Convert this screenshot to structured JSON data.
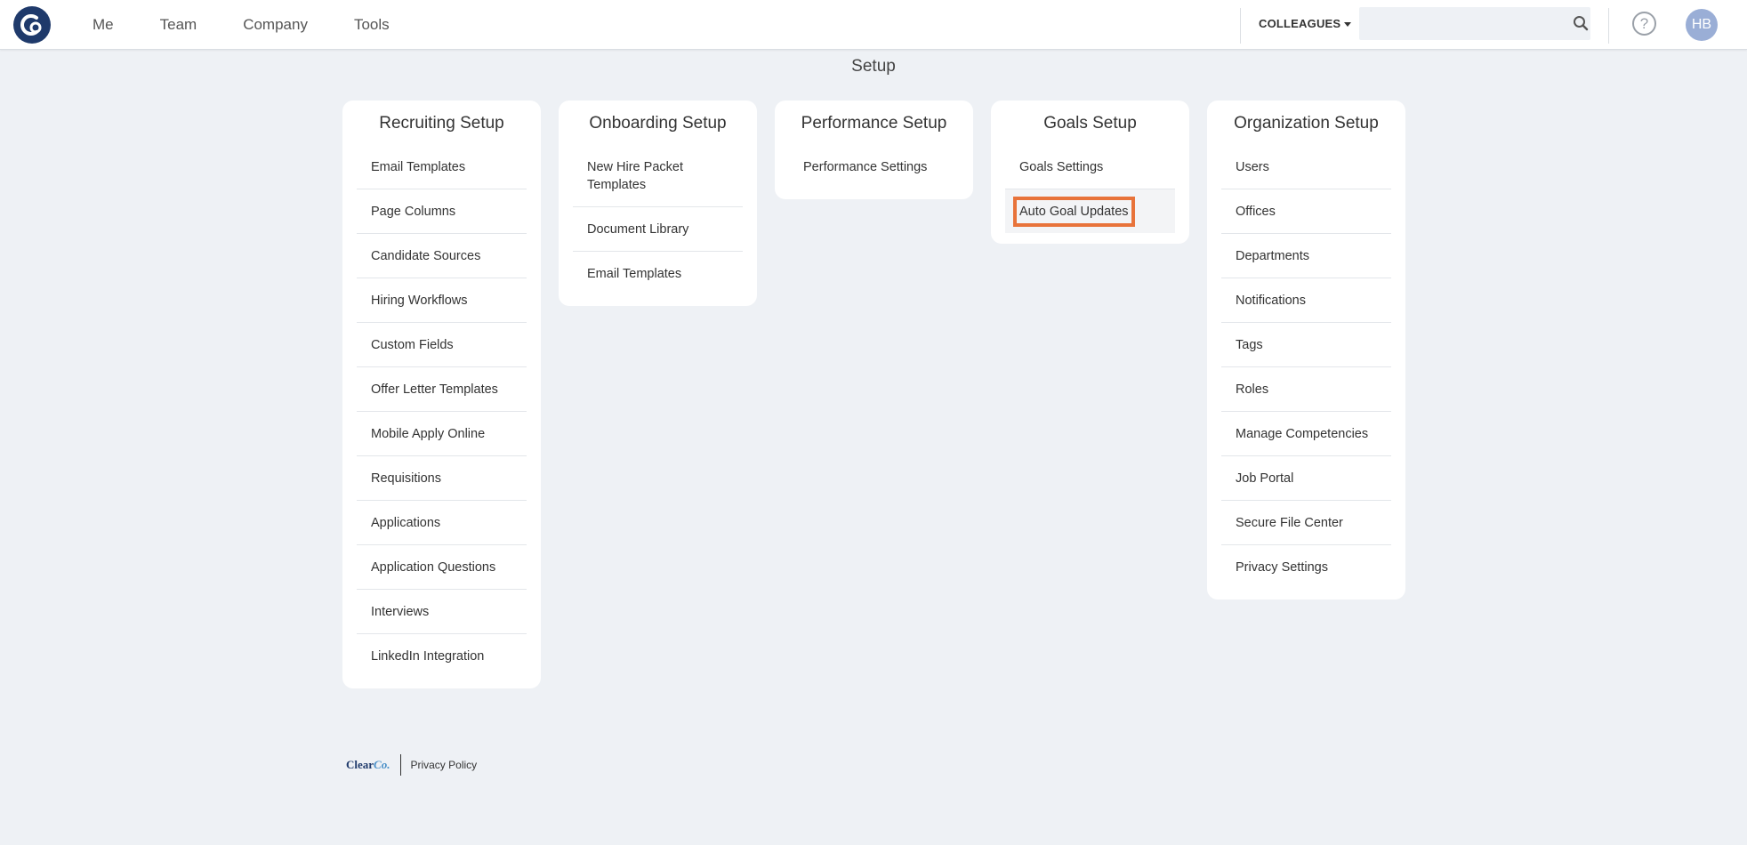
{
  "nav": {
    "items": [
      "Me",
      "Team",
      "Company",
      "Tools"
    ],
    "colleagues_label": "COLLEAGUES",
    "search_placeholder": "",
    "help_label": "?",
    "avatar_initials": "HB"
  },
  "page": {
    "title": "Setup"
  },
  "cards": [
    {
      "title": "Recruiting Setup",
      "items": [
        "Email Templates",
        "Page Columns",
        "Candidate Sources",
        "Hiring Workflows",
        "Custom Fields",
        "Offer Letter Templates",
        "Mobile Apply Online",
        "Requisitions",
        "Applications",
        "Application Questions",
        "Interviews",
        "LinkedIn Integration"
      ]
    },
    {
      "title": "Onboarding Setup",
      "items": [
        "New Hire Packet Templates",
        "Document Library",
        "Email Templates"
      ]
    },
    {
      "title": "Performance Setup",
      "items": [
        "Performance Settings"
      ]
    },
    {
      "title": "Goals Setup",
      "items": [
        "Goals Settings",
        "Auto Goal Updates"
      ]
    },
    {
      "title": "Organization Setup",
      "items": [
        "Users",
        "Offices",
        "Departments",
        "Notifications",
        "Tags",
        "Roles",
        "Manage Competencies",
        "Job Portal",
        "Secure File Center",
        "Privacy Settings"
      ]
    }
  ],
  "footer": {
    "logo_part1": "Clear",
    "logo_part2": "Co.",
    "privacy_link": "Privacy Policy"
  },
  "colors": {
    "brand": "#1f3a6b",
    "highlight": "#e8733a",
    "background": "#eef1f5"
  }
}
